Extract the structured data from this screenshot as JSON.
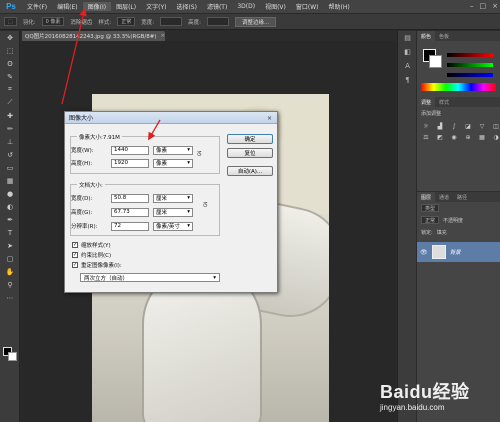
{
  "app": {
    "logo": "Ps",
    "menu": [
      "文件(F)",
      "编辑(E)",
      "图像(I)",
      "图层(L)",
      "文字(Y)",
      "选择(S)",
      "滤镜(T)",
      "3D(D)",
      "视图(V)",
      "窗口(W)",
      "帮助(H)"
    ],
    "active_menu_index": 2,
    "window_controls": [
      "–",
      "□",
      "×"
    ]
  },
  "options": {
    "feather_label": "羽化:",
    "feather_value": "0 像素",
    "antialias_label": "消除锯齿",
    "style_label": "样式:",
    "style_value": "正常",
    "width_label": "宽度:",
    "height_label": "高度:",
    "refine_button": "调整边缘..."
  },
  "document": {
    "tab_title": "QQ图片20160828142243.jpg @ 33.3%(RGB/8#)",
    "close": "×"
  },
  "dialog": {
    "title": "图像大小",
    "close": "×",
    "pixel_dims_label": "像素大小:7.91M",
    "width_label": "宽度(W):",
    "width_value": "1440",
    "width_unit": "像素",
    "height_label": "高度(H):",
    "height_value": "1920",
    "height_unit": "像素",
    "doc_size_label": "文档大小:",
    "doc_width_label": "宽度(D):",
    "doc_width_value": "50.8",
    "doc_width_unit": "厘米",
    "doc_height_label": "高度(G):",
    "doc_height_value": "67.73",
    "doc_height_unit": "厘米",
    "resolution_label": "分辨率(R):",
    "resolution_value": "72",
    "resolution_unit": "像素/英寸",
    "ok_button": "确定",
    "reset_button": "复位",
    "auto_button": "自动(A)...",
    "scale_styles": "缩放样式(Y)",
    "constrain": "约束比例(C)",
    "resample": "重定图像像素(I):",
    "resample_method": "两次立方（自动）",
    "checkmark": "✓"
  },
  "panels": {
    "color_tabs": [
      "颜色",
      "色板"
    ],
    "adjust_tabs": [
      "调整",
      "样式"
    ],
    "adjust_title": "添加调整",
    "layers_tabs": [
      "图层",
      "通道",
      "路径"
    ],
    "kind_label": "类型",
    "blend_mode": "正常",
    "opacity_label": "不透明度",
    "lock_label": "锁定:",
    "fill_label": "填充",
    "layer_name": "背景"
  },
  "watermark": {
    "brand": "Baidu经验",
    "url": "jingyan.baidu.com"
  },
  "colors": {
    "annotation_red": "#e02020",
    "selected_layer": "#5d7da8"
  }
}
